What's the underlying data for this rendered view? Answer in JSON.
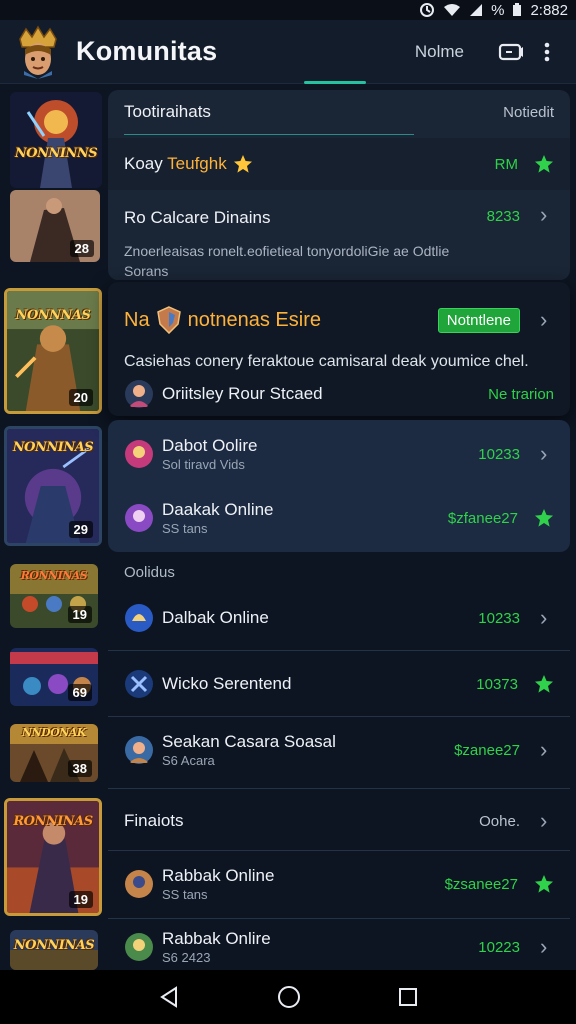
{
  "status": {
    "time": "2:882",
    "battery_label": "%"
  },
  "app": {
    "title": "Komunitas",
    "action": "Nolme"
  },
  "rail": [
    {
      "title": "NONNINNS",
      "count": ""
    },
    {
      "title": "",
      "count": "28"
    },
    {
      "title": "NONNNAS",
      "count": "20"
    },
    {
      "title": "NONNINAS",
      "count": "29"
    },
    {
      "title": "RONNINAS",
      "count": "19"
    },
    {
      "title": "",
      "count": "69"
    },
    {
      "title": "NNDONAK",
      "count": "38"
    },
    {
      "title": "RONNINAS",
      "count": "19"
    },
    {
      "title": "NONNINAS",
      "count": ""
    }
  ],
  "panel_top": {
    "header_title": "Tootiraihats",
    "header_right": "Notiedit",
    "featured_title_a": "Koay",
    "featured_title_b": "Teufghk",
    "featured_value": "RM",
    "row2_title": "Ro Calcare Dinains",
    "row2_value": "8233",
    "row2_desc": "Znoerleaisas ronelt.eofietieal tonyordoliGie ae Odtlie",
    "row2_desc2": "Sorans"
  },
  "panel_highlight": {
    "title_a": "Na",
    "title_b": "notnenas Esire",
    "badge": "Notntlene",
    "desc": "Casiehas conery feraktoue camisaral deak youmice chel.",
    "row_title": "Oriitsley Rour Stcaed",
    "row_value": "Ne trarion"
  },
  "panel_mid": {
    "row1_title": "Dabot Oolire",
    "row1_sub": "Sol tiravd Vids",
    "row1_value": "10233",
    "row2_title": "Daakak Online",
    "row2_sub": "SS tans",
    "row2_value": "$zfanee27"
  },
  "section_label": "Oolidus",
  "list": [
    {
      "title": "Dalbak Online",
      "sub": "",
      "value": "10233",
      "kind": "chev"
    },
    {
      "title": "Wicko Serentend",
      "sub": "",
      "value": "10373",
      "kind": "star"
    },
    {
      "title": "Seakan Casara Soasal",
      "sub": "S6 Acara",
      "value": "$zanee27",
      "kind": "chev"
    }
  ],
  "finaiots": {
    "title": "Finaiots",
    "value": "Oohe."
  },
  "list2": [
    {
      "title": "Rabbak Online",
      "sub": "SS tans",
      "value": "$zsanee27",
      "kind": "star"
    },
    {
      "title": "Rabbak Onlire",
      "sub": "S6 2423",
      "value": "10223",
      "kind": "chev"
    }
  ],
  "colors": {
    "accent_green": "#2fd24a",
    "badge_green": "#1fa53a",
    "gold": "#c79a3a",
    "bg": "#0d1522"
  }
}
